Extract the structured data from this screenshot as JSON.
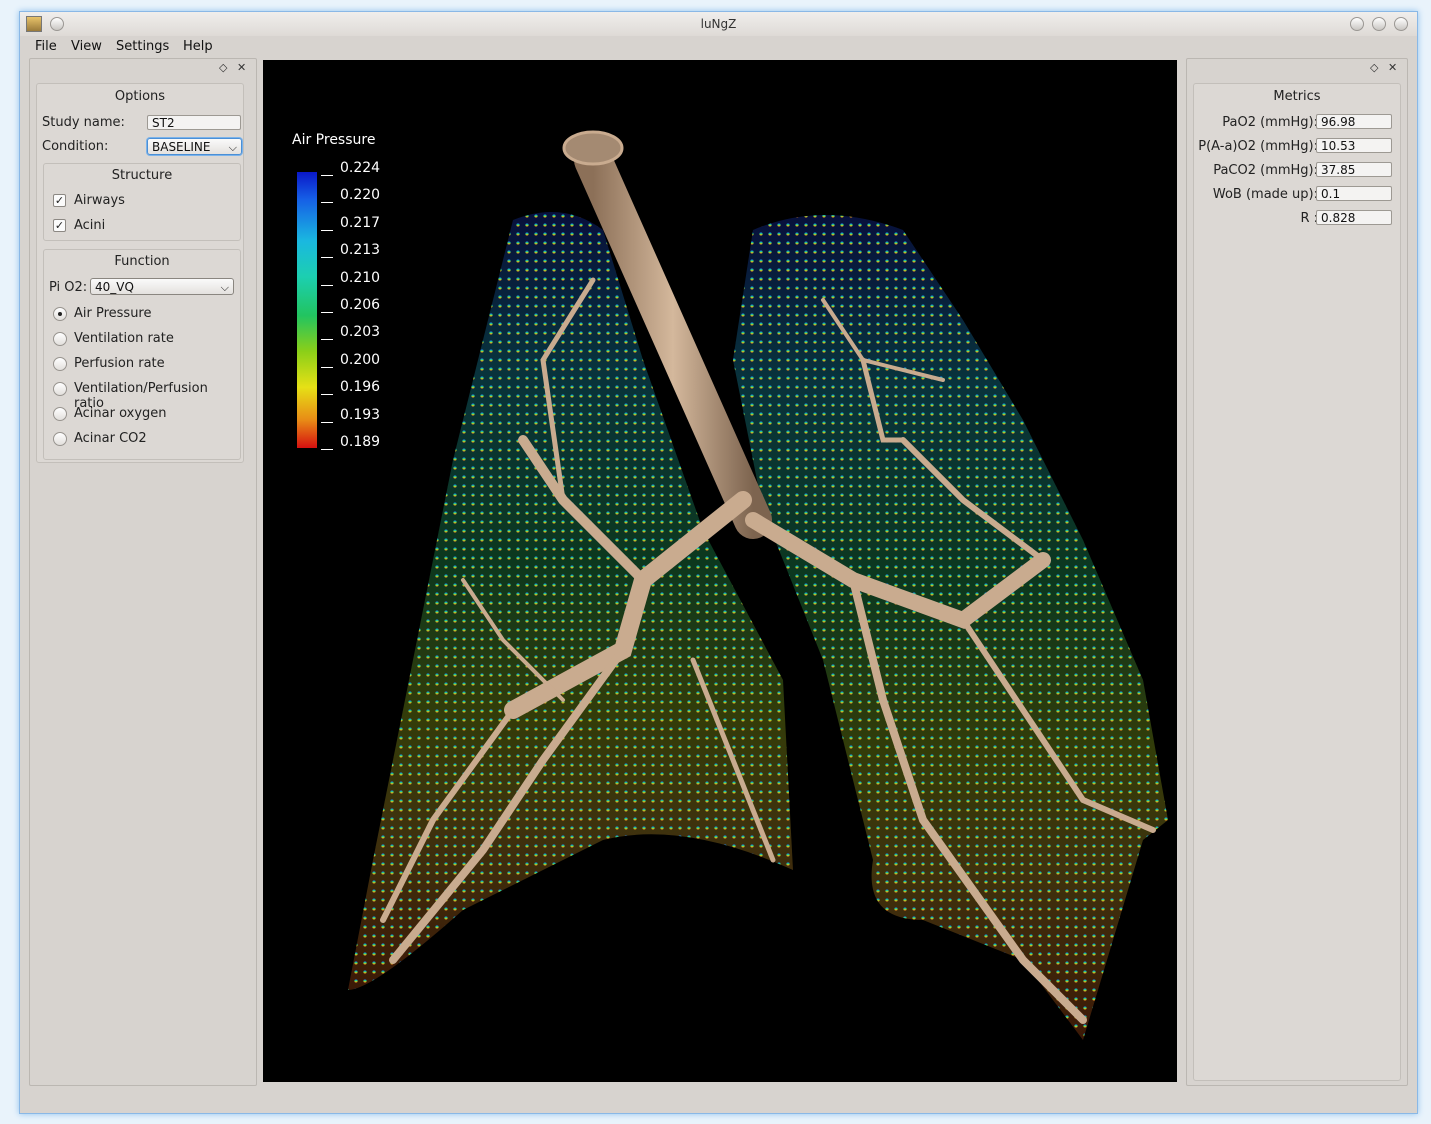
{
  "window": {
    "title": "luNgZ"
  },
  "menu": {
    "file": "File",
    "view": "View",
    "settings": "Settings",
    "help": "Help"
  },
  "options": {
    "title": "Options",
    "study_label": "Study name:",
    "study_value": "ST2",
    "condition_label": "Condition:",
    "condition_value": "BASELINE",
    "structure": {
      "title": "Structure",
      "airways": "Airways",
      "acini": "Acini",
      "airways_checked": true,
      "acini_checked": true
    },
    "function": {
      "title": "Function",
      "pio2_label": "Pi O2:",
      "pio2_value": "40_VQ",
      "radios": [
        "Air Pressure",
        "Ventilation rate",
        "Perfusion rate",
        "Ventilation/Perfusion ratio",
        "Acinar oxygen",
        "Acinar CO2"
      ],
      "selected": "Air Pressure"
    }
  },
  "viewport": {
    "legend_title": "Air Pressure",
    "colorbar_ticks": [
      "0.224",
      "0.220",
      "0.217",
      "0.213",
      "0.210",
      "0.206",
      "0.203",
      "0.200",
      "0.196",
      "0.193",
      "0.189"
    ],
    "colors": {
      "high": "#0a18c8",
      "mid": "#22c460",
      "low": "#d51010",
      "airway": "#c9ab8f"
    }
  },
  "metrics": {
    "title": "Metrics",
    "pao2_label": "PaO2 (mmHg):",
    "pao2": "96.98",
    "aa_label": "P(A-a)O2 (mmHg):",
    "aa": "10.53",
    "paco2_label": "PaCO2 (mmHg):",
    "paco2": "37.85",
    "wob_label": "WoB (made up):",
    "wob": "0.1",
    "r_label": "R :",
    "r": "0.828"
  }
}
